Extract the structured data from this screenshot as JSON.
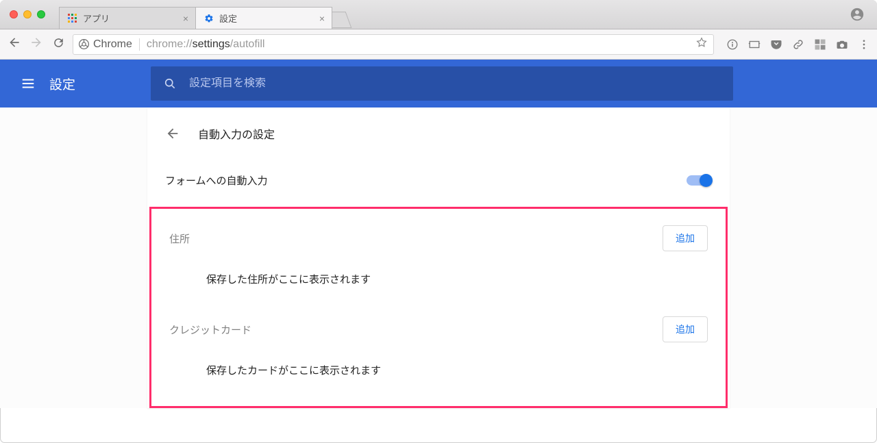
{
  "tabs": [
    {
      "title": "アプリ"
    },
    {
      "title": "設定"
    }
  ],
  "omnibox": {
    "chip": "Chrome",
    "url_dim1": "chrome://",
    "url_strong": "settings",
    "url_dim2": "/autofill"
  },
  "header": {
    "title": "設定",
    "search_placeholder": "設定項目を検索"
  },
  "page": {
    "subtitle": "自動入力の設定",
    "form_autofill_label": "フォームへの自動入力",
    "sections": {
      "address": {
        "title": "住所",
        "add": "追加",
        "empty": "保存した住所がここに表示されます"
      },
      "card": {
        "title": "クレジットカード",
        "add": "追加",
        "empty": "保存したカードがここに表示されます"
      }
    }
  }
}
